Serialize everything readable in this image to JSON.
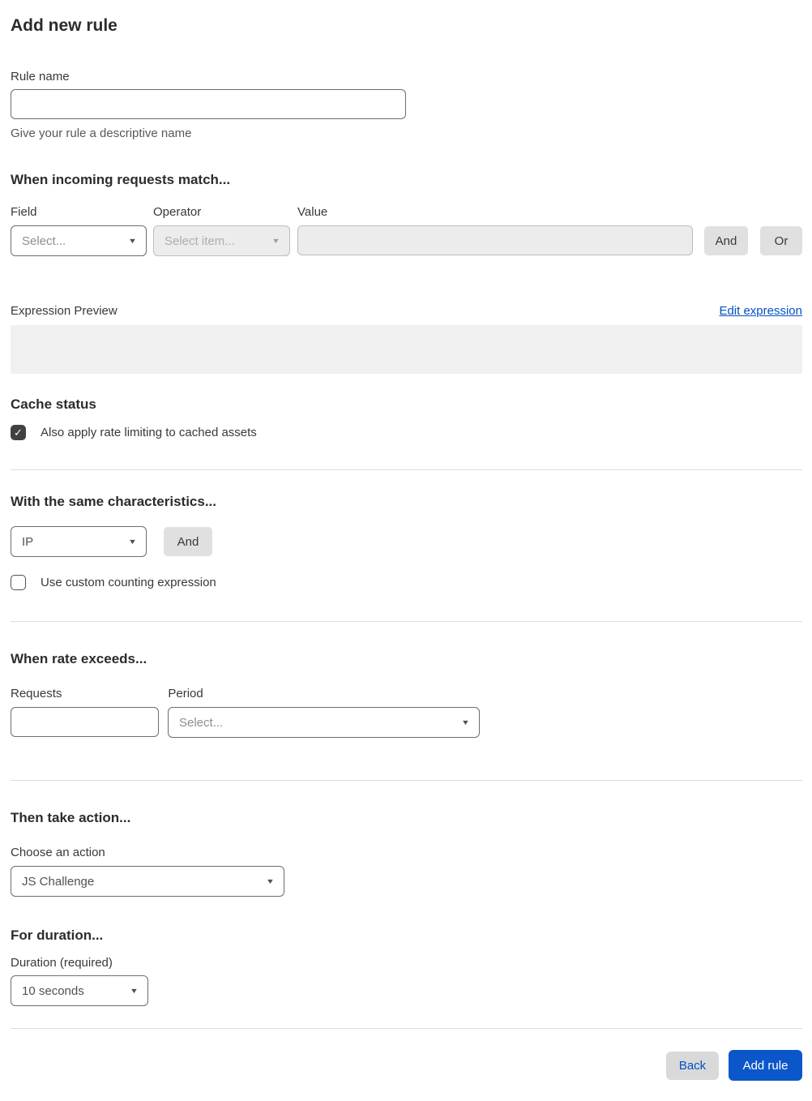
{
  "page": {
    "title": "Add new rule"
  },
  "icons": {
    "chevron_down": "▼",
    "check": "✓"
  },
  "rule_name": {
    "label": "Rule name",
    "value": "",
    "helper": "Give your rule a descriptive name"
  },
  "match": {
    "heading": "When incoming requests match...",
    "field": {
      "label": "Field",
      "selected": "Select..."
    },
    "operator": {
      "label": "Operator",
      "selected": "Select item...",
      "disabled": true
    },
    "value": {
      "label": "Value",
      "value": "",
      "disabled": true
    },
    "and_label": "And",
    "or_label": "Or"
  },
  "expression": {
    "label": "Expression Preview",
    "edit_link": "Edit expression",
    "preview_value": ""
  },
  "cache": {
    "heading": "Cache status",
    "checkbox_label": "Also apply rate limiting to cached assets",
    "checked": true
  },
  "characteristics": {
    "heading": "With the same characteristics...",
    "selected": "IP",
    "and_label": "And",
    "checkbox_label": "Use custom counting expression",
    "checked": false
  },
  "rate": {
    "heading": "When rate exceeds...",
    "requests": {
      "label": "Requests",
      "value": ""
    },
    "period": {
      "label": "Period",
      "selected": "Select..."
    }
  },
  "action": {
    "heading": "Then take action...",
    "label": "Choose an action",
    "selected": "JS Challenge"
  },
  "duration": {
    "heading": "For duration...",
    "label": "Duration (required)",
    "selected": "10 seconds"
  },
  "footer": {
    "back_label": "Back",
    "add_rule_label": "Add rule"
  },
  "colors": {
    "accent_blue": "#0051c3",
    "primary_button": "#0b57c9"
  }
}
